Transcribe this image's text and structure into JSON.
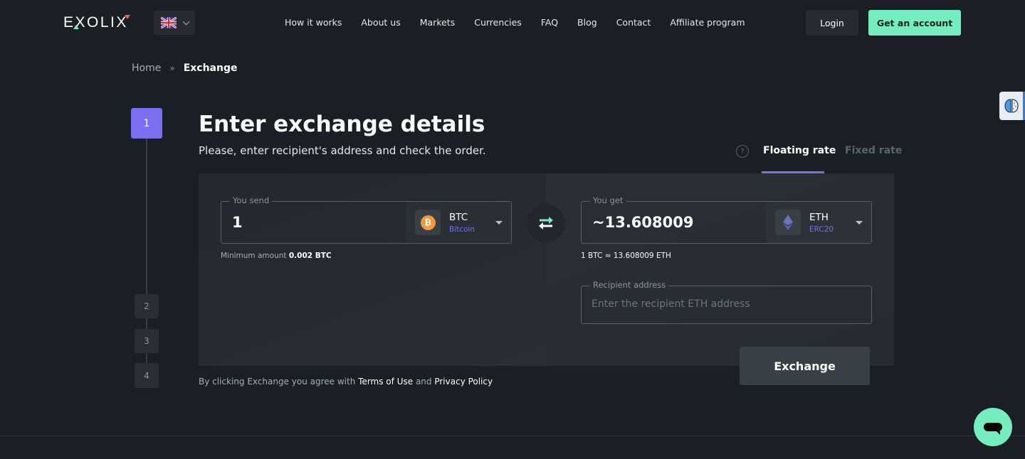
{
  "header": {
    "logo": "EXOLIX",
    "language": "en-GB",
    "nav": [
      "How it works",
      "About us",
      "Markets",
      "Currencies",
      "FAQ",
      "Blog",
      "Contact",
      "Affiliate program"
    ],
    "login_label": "Login",
    "account_label": "Get an account"
  },
  "breadcrumb": {
    "home": "Home",
    "separator": "»",
    "current": "Exchange"
  },
  "steps": [
    "1",
    "2",
    "3",
    "4"
  ],
  "active_step": 1,
  "page": {
    "title": "Enter exchange details",
    "subtitle": "Please, enter recipient's address and check the order."
  },
  "rate_tabs": {
    "help_icon": "?",
    "floating": "Floating rate",
    "fixed": "Fixed rate",
    "selected": "floating"
  },
  "send": {
    "label": "You send",
    "amount": "1",
    "ticker": "BTC",
    "name": "Bitcoin",
    "icon": "bitcoin-icon",
    "min_label": "Minimum amount",
    "min_value": "0.002 BTC"
  },
  "get": {
    "label": "You get",
    "amount": "~13.608009",
    "ticker": "ETH",
    "network": "ERC20",
    "icon": "ethereum-icon",
    "rate": "1 BTC ≈ 13.608009 ETH"
  },
  "recipient": {
    "label": "Recipient address",
    "placeholder": "Enter the recipient ETH address",
    "value": ""
  },
  "exchange_label": "Exchange",
  "terms": {
    "prefix": "By clicking Exchange you agree with",
    "terms_link": "Terms of Use",
    "and": "and",
    "privacy_link": "Privacy Policy"
  },
  "colors": {
    "accent": "#7b6ef0",
    "brand_green": "#74eec0",
    "background": "#1b1e22",
    "btc_orange": "#f09a3b"
  }
}
